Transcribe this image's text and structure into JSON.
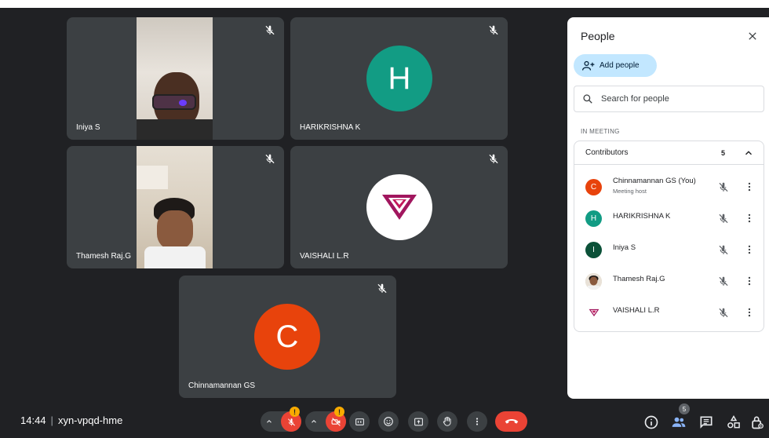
{
  "tiles": [
    {
      "name": "Iniya S"
    },
    {
      "name": "HARIKRISHNA K",
      "initial": "H",
      "color": "#129c84"
    },
    {
      "name": "Thamesh Raj.G"
    },
    {
      "name": "VAISHALI L.R"
    },
    {
      "name": "Chinnamannan GS",
      "initial": "C",
      "color": "#e8430c"
    }
  ],
  "bottom_bar": {
    "time": "14:44",
    "separator": "|",
    "meeting_code": "xyn-vpqd-hme",
    "mic_badge": "!",
    "cam_badge": "!",
    "people_count": "5"
  },
  "people_panel": {
    "title": "People",
    "add_label": "Add people",
    "search_placeholder": "Search for people",
    "section": "IN MEETING",
    "group_label": "Contributors",
    "group_count": "5",
    "participants": [
      {
        "name": "Chinnamannan GS (You)",
        "sub": "Meeting host",
        "initial": "C",
        "color": "#e8430c"
      },
      {
        "name": "HARIKRISHNA K",
        "initial": "H",
        "color": "#129c84"
      },
      {
        "name": "Iniya S",
        "initial": "I",
        "color": "#0b5138"
      },
      {
        "name": "Thamesh Raj.G"
      },
      {
        "name": "VAISHALI L.R"
      }
    ]
  },
  "colors": {
    "background": "#202124",
    "tile": "#3c4043",
    "hangup": "#ea4335",
    "warning": "#f9ab00",
    "accent_blue": "#8ab4f8",
    "add_button": "#c2e7ff"
  }
}
